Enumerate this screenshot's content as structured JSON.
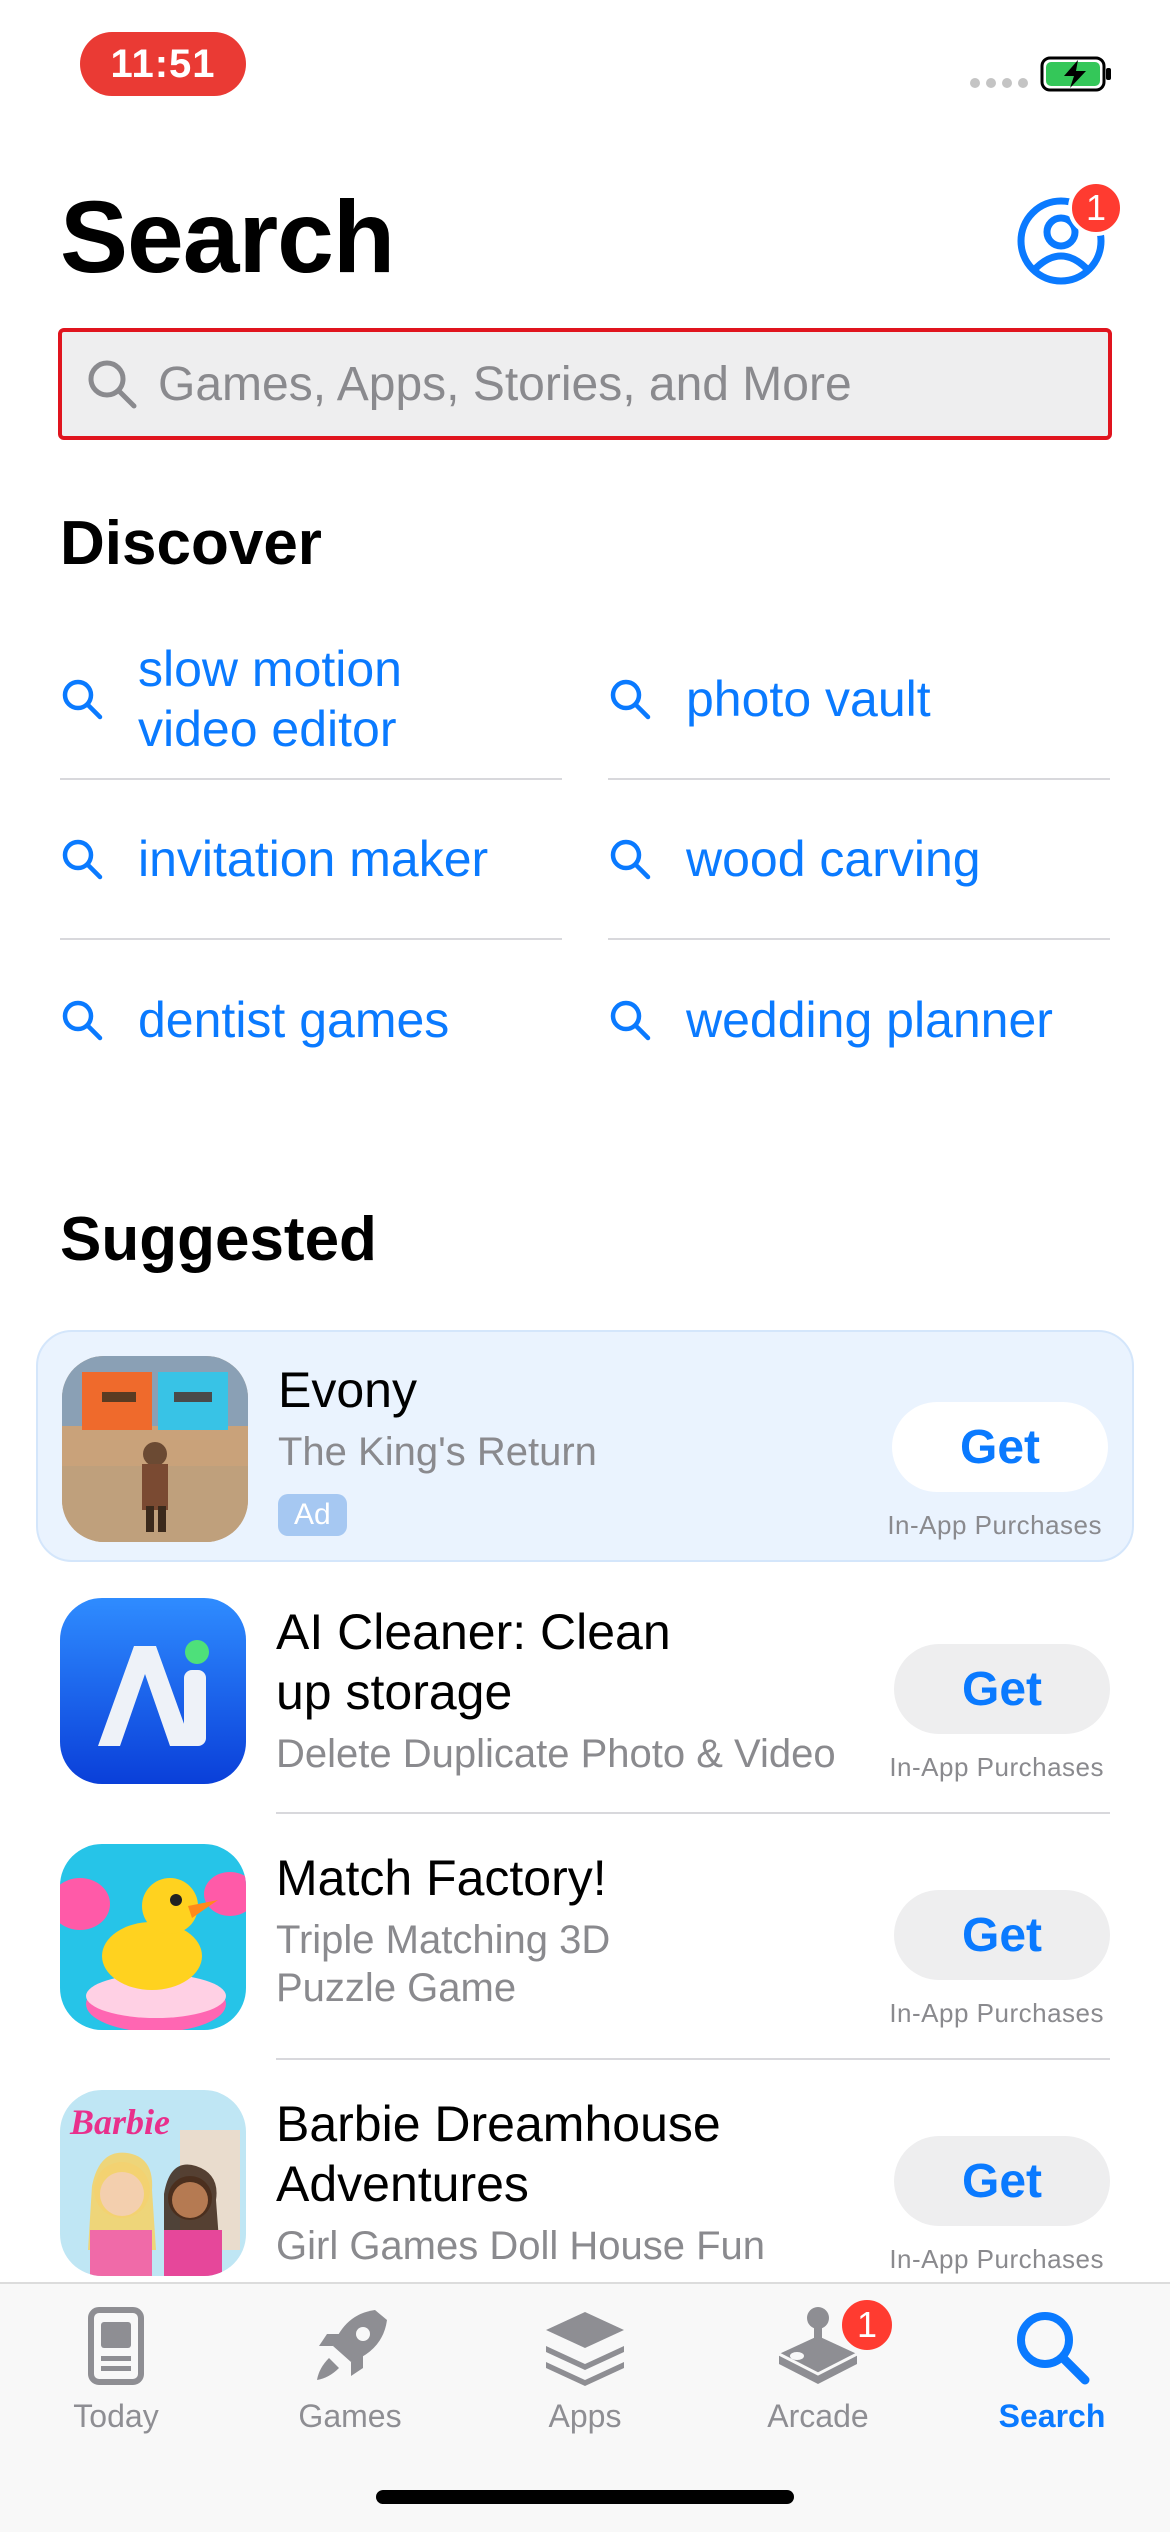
{
  "status_bar": {
    "time": "11:51",
    "battery": "charging"
  },
  "header": {
    "title": "Search",
    "account_badge": "1"
  },
  "search": {
    "placeholder": "Games, Apps, Stories, and More",
    "value": ""
  },
  "discover": {
    "title": "Discover",
    "items": [
      {
        "label": "slow motion video editor"
      },
      {
        "label": "photo vault"
      },
      {
        "label": "invitation maker"
      },
      {
        "label": "wood carving"
      },
      {
        "label": "dentist games"
      },
      {
        "label": "wedding planner"
      }
    ]
  },
  "suggested": {
    "title": "Suggested",
    "apps": [
      {
        "name": "Evony",
        "subtitle": "The King's Return",
        "badge": "Ad",
        "action": "Get",
        "note": "In-App Purchases"
      },
      {
        "name": "AI Cleaner: Clean up storage",
        "subtitle": "Delete Duplicate Photo & Video",
        "action": "Get",
        "note": "In-App Purchases"
      },
      {
        "name": "Match Factory!",
        "subtitle": "Triple Matching 3D Puzzle Game",
        "action": "Get",
        "note": "In-App Purchases"
      },
      {
        "name": "Barbie Dreamhouse Adventures",
        "subtitle": "Girl Games Doll House Fun",
        "action": "Get",
        "note": "In-App Purchases"
      }
    ]
  },
  "tab_bar": {
    "tabs": [
      {
        "label": "Today",
        "icon": "today-icon"
      },
      {
        "label": "Games",
        "icon": "rocket-icon"
      },
      {
        "label": "Apps",
        "icon": "layers-icon"
      },
      {
        "label": "Arcade",
        "icon": "joystick-icon",
        "badge": "1"
      },
      {
        "label": "Search",
        "icon": "search-icon",
        "active": true
      }
    ]
  },
  "colors": {
    "accent": "#0a7aff",
    "badge": "#ff3b30",
    "time_pill": "#ea3a34"
  }
}
